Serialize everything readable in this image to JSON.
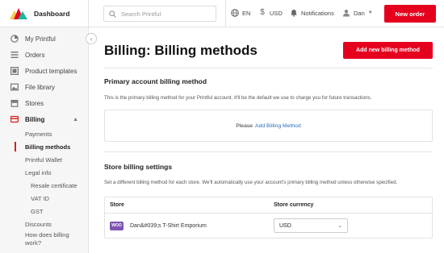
{
  "brand": {
    "name": "Dashboard"
  },
  "colors": {
    "accent": "#e5001e",
    "link": "#2a6cb5",
    "woo": "#7f54b3"
  },
  "sidebar": {
    "items": [
      {
        "label": "My Printful",
        "icon": "pie-chart-icon"
      },
      {
        "label": "Orders",
        "icon": "list-icon"
      },
      {
        "label": "Product templates",
        "icon": "template-icon"
      },
      {
        "label": "File library",
        "icon": "image-icon"
      },
      {
        "label": "Stores",
        "icon": "store-icon"
      },
      {
        "label": "Billing",
        "icon": "credit-card-icon",
        "expanded": true
      }
    ],
    "billing_sub": [
      {
        "label": "Payments"
      },
      {
        "label": "Billing methods",
        "active": true
      },
      {
        "label": "Printful Wallet"
      },
      {
        "label": "Legal info"
      },
      {
        "label": "Resale certificate",
        "deep": true
      },
      {
        "label": "VAT ID",
        "deep": true
      },
      {
        "label": "GST",
        "deep": true
      },
      {
        "label": "Discounts"
      },
      {
        "label": "How does billing work?"
      }
    ]
  },
  "topbar": {
    "search_placeholder": "Search Printful",
    "language": "EN",
    "currency": "USD",
    "notifications": "Notifications",
    "user": "Dan",
    "new_order": "New order"
  },
  "main": {
    "title": "Billing: Billing methods",
    "add_button": "Add new billing method",
    "primary": {
      "title": "Primary account billing method",
      "desc": "This is the primary billing method for your Printful account. It'll be the default we use to charge you for future transactions.",
      "prompt": "Please",
      "link": "Add Billing Method"
    },
    "store": {
      "title": "Store billing settings",
      "desc": "Set a different billing method for each store. We'll automatically use your account's primary billing method unless otherwise specified.",
      "col_store": "Store",
      "col_currency": "Store currency",
      "rows": [
        {
          "badge": "WOO",
          "name": "Dan&#039;s T-Shirt Emporium",
          "currency": "USD"
        }
      ]
    }
  }
}
